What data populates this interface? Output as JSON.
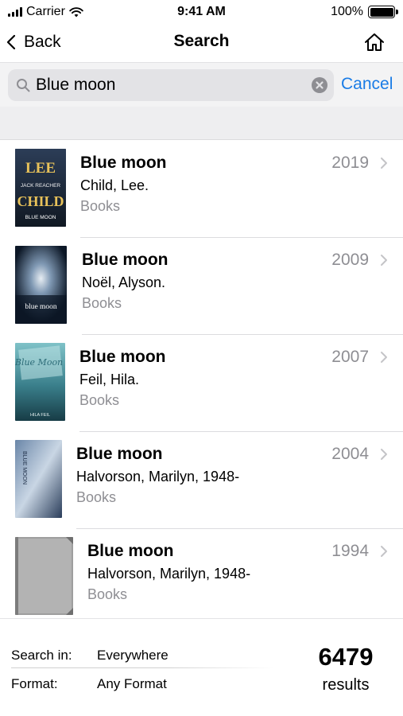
{
  "status_bar": {
    "carrier": "Carrier",
    "time": "9:41 AM",
    "battery": "100%",
    "icons": [
      "signal-icon",
      "wifi-icon",
      "battery-icon"
    ]
  },
  "nav": {
    "back_label": "Back",
    "title": "Search",
    "home_icon": "home-icon"
  },
  "search": {
    "query": "Blue moon",
    "cancel_label": "Cancel",
    "icons": [
      "search-icon",
      "clear-icon"
    ]
  },
  "results": [
    {
      "title": "Blue moon",
      "author": "Child, Lee.",
      "type": "Books",
      "year": "2019",
      "cover_text": [
        "LEE",
        "JACK REACHER",
        "CHILD",
        "BLUE MOON"
      ]
    },
    {
      "title": "Blue moon",
      "author": "Noël, Alyson.",
      "type": "Books",
      "year": "2009",
      "cover_text": [
        "blue moon"
      ]
    },
    {
      "title": "Blue moon",
      "author": "Feil, Hila.",
      "type": "Books",
      "year": "2007",
      "cover_text": [
        "Blue Moon",
        "HILA FEIL"
      ]
    },
    {
      "title": "Blue moon",
      "author": "Halvorson, Marilyn, 1948-",
      "type": "Books",
      "year": "2004",
      "cover_text": [
        "BLUE MOON"
      ]
    },
    {
      "title": "Blue moon",
      "author": "Halvorson, Marilyn, 1948-",
      "type": "Books",
      "year": "1994",
      "cover_text": []
    }
  ],
  "footer": {
    "search_in_label": "Search in:",
    "search_in_value": "Everywhere",
    "format_label": "Format:",
    "format_value": "Any Format",
    "count": "6479",
    "count_label": "results"
  },
  "colors": {
    "accent": "#1a7ce6",
    "secondary_text": "#8e8e93",
    "search_bg": "#f3f3f4",
    "field_bg": "#e3e3e6"
  }
}
